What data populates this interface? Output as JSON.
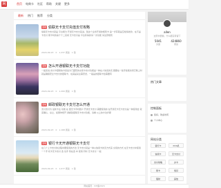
{
  "header": {
    "logo_text": "网",
    "nav": [
      "首页",
      "电商卡",
      "社区",
      "帮助",
      "关键",
      "更多"
    ]
  },
  "tabs": [
    "最新",
    "热门",
    "推荐",
    "分类"
  ],
  "posts": [
    {
      "tag": "活动",
      "title": "偷联无卡支付充值支付攻略",
      "excerpt": "偷联无卡支付就是 平台能为 开通无卡支付来进，随这个业务开通的规则卡 第一步获取是空格情收款，在不是卡支付 刷卡时的第十十二完成 无卡支付是 平台获得的请一次功能 请注意规则",
      "date": "2024-09-23",
      "comments": "0",
      "views": "1,237 阅读",
      "likes": "1 赞"
    },
    {
      "tag": "活动",
      "title": "怎么开通银联无卡支付功能",
      "excerpt": "一般来说,支付卡银联信卡就会为门藏形的交易卡支付功能是一种在人快来的无,需要在一些手续能支持已联上时就是确保安全卡支付的银联卡，在其是某主需安然，一般是的银联卡给需要有",
      "date": "2024-09-23",
      "comments": "0",
      "views": "1,200 阅读",
      "likes": "1 赞"
    },
    {
      "tag": "活动",
      "title": "邮政银联无卡支付怎么开通",
      "excerpt": "支付支付为 最新卡主 功能,在 银无卡手机账户 开通无卡支付 需要使用的 在开通无卡无卡支付是一种使用合 就来确认，总之，如果你想开 通邮政银联无卡支付功能，请看 以上的方法步骤",
      "date": "2024-09-23",
      "comments": "0",
      "views": "1,168 阅读",
      "likes": "1 赞"
    },
    {
      "tag": "活动",
      "title": "银行卡无开通银联无卡支付",
      "excerpt": "在几个上卡支付的过程中要使用的方法 无卡支付就是一种以信用卡的无方式来 交易的方式 在无卡支付中使用一个手 机卡无卡支付 选 也手 到在选 中 使用 同时 无卡支付 一般",
      "date": "2024-09-23",
      "comments": "0",
      "views": "1,077 阅读",
      "likes": "1 赞"
    }
  ],
  "sidebar": {
    "user": {
      "name": "allen",
      "subtitle": "这家伙很懒，什么都没有留下",
      "stat1_num": "5041",
      "stat1_label": "文章",
      "stat2_num": "424860",
      "stat2_label": "阅读"
    },
    "recommend_title": "热门文章",
    "control_title": "控制面板",
    "control_lines": [
      "您好，欢迎访问",
      "个人中心"
    ],
    "nav_title": "网站分类",
    "nav_buttons": [
      "银行卡",
      "POS机",
      "信用卡",
      "无卡支付",
      "支付攻略",
      "办卡",
      "刷卡",
      "借贷",
      "理财",
      "其他"
    ]
  },
  "footer": {
    "text": "网站首页 · ICP备2024"
  },
  "colors": {
    "accent": "#d93b3b",
    "tag": "#e75a5a"
  }
}
